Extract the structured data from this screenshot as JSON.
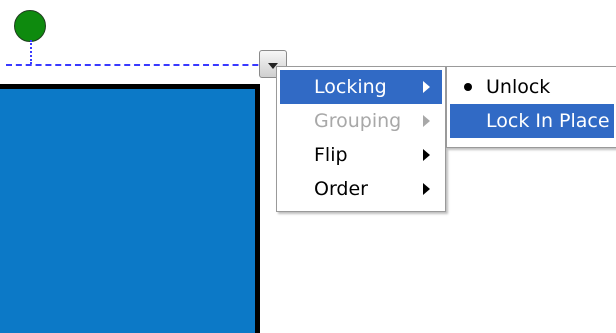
{
  "context_menu": {
    "items": [
      {
        "label": "Locking",
        "state": "active"
      },
      {
        "label": "Grouping",
        "state": "disabled"
      },
      {
        "label": "Flip",
        "state": "normal"
      },
      {
        "label": "Order",
        "state": "normal"
      }
    ]
  },
  "submenu": {
    "items": [
      {
        "label": "Unlock",
        "selected": true
      },
      {
        "label": "Lock In Place",
        "highlighted": true
      }
    ]
  },
  "colors": {
    "shape_fill": "#0c79c7",
    "rotate_handle": "#0e8a0e",
    "highlight": "#316ac5",
    "selection_line": "#3a3aff"
  },
  "icons": {
    "rotate_handle": "rotate-handle-icon",
    "menu_dropdown": "chevron-down-icon",
    "submenu_arrow": "chevron-right-icon",
    "radio_bullet": "bullet-icon"
  }
}
